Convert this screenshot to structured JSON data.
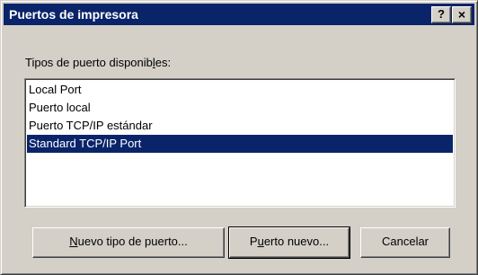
{
  "window": {
    "title": "Puertos de impresora",
    "help_label": "?",
    "close_label": "×"
  },
  "port_types": {
    "label": "Tipos de puerto disponibles:",
    "items": [
      {
        "label": "Local Port",
        "selected": false
      },
      {
        "label": "Puerto local",
        "selected": false
      },
      {
        "label": "Puerto TCP/IP estándar",
        "selected": false
      },
      {
        "label": "Standard TCP/IP Port",
        "selected": true
      }
    ]
  },
  "buttons": {
    "new_port_type": "Nuevo tipo de puerto...",
    "new_port": "Puerto nuevo...",
    "cancel": "Cancelar"
  },
  "colors": {
    "titlebar": "#0a246a",
    "face": "#d4d0c8",
    "selection": "#0a246a"
  }
}
